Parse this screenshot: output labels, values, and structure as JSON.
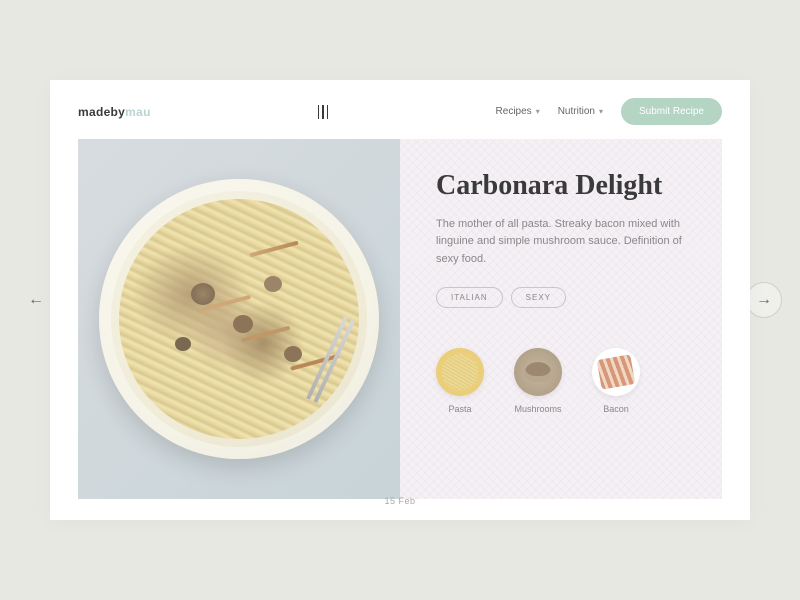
{
  "logo": {
    "bold": "madeby",
    "light": "mau"
  },
  "nav": {
    "items": [
      {
        "label": "Recipes"
      },
      {
        "label": "Nutrition"
      }
    ],
    "submit_label": "Submit Recipe"
  },
  "recipe": {
    "title": "Carbonara Delight",
    "description": "The mother of all pasta. Streaky bacon mixed with linguine and simple mushroom sauce. Definition of sexy food.",
    "tags": [
      "ITALIAN",
      "SEXY"
    ],
    "ingredients": [
      {
        "name": "Pasta"
      },
      {
        "name": "Mushrooms"
      },
      {
        "name": "Bacon"
      }
    ],
    "date": "15 Feb"
  }
}
